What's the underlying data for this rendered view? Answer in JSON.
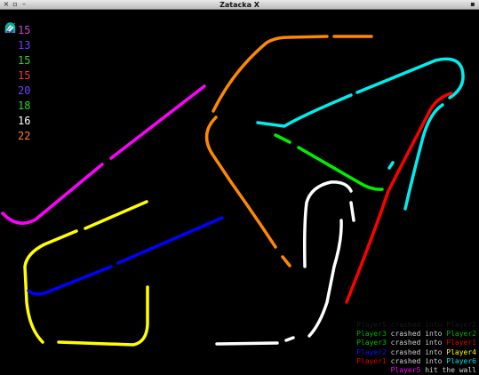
{
  "window": {
    "title": "Zatacka X",
    "buttons": [
      "×",
      "▫",
      "–"
    ]
  },
  "powerups": [
    {
      "icon": "speed-icon",
      "color": "#7f3fbf",
      "count": "15"
    },
    {
      "icon": "warning-icon",
      "color": "#d97c00",
      "count": "13"
    },
    {
      "icon": "lightning-icon",
      "color": "#7fc000",
      "count": "15"
    },
    {
      "icon": "reverse-icon",
      "color": "#d00000",
      "count": "15"
    },
    {
      "icon": "ring-icon",
      "color": "#7f00d0",
      "count": "20"
    },
    {
      "icon": "magnet-icon",
      "color": "#00c0a0",
      "count": "18"
    },
    {
      "icon": "eraser-icon",
      "color": "#ffffff",
      "count": "16"
    },
    {
      "icon": "chaos-icon",
      "color": "#00a0a0",
      "count": "22"
    }
  ],
  "powerup_count_colors": [
    "#d040d0",
    "#7040ff",
    "#30d030",
    "#ff3030",
    "#7040ff",
    "#30d030",
    "#ffffff",
    "#ff8030"
  ],
  "log": [
    {
      "a": "Player5",
      "a_color": "#1a1a1a",
      "verb": "crashed into",
      "b": "Player2",
      "b_color": "#1a1a1a"
    },
    {
      "a": "Player3",
      "a_color": "#00b000",
      "verb": "crashed into",
      "b": "Player2",
      "b_color": "#00b000"
    },
    {
      "a": "Player3",
      "a_color": "#00c000",
      "verb": "crashed into",
      "b": "Player1",
      "b_color": "#e00000"
    },
    {
      "a": "Player2",
      "a_color": "#1010ff",
      "verb": "crashed into",
      "b": "Player4",
      "b_color": "#ffff00"
    },
    {
      "a": "Player1",
      "a_color": "#e00000",
      "verb": "crashed into",
      "b": "Player6",
      "b_color": "#00e0e0"
    },
    {
      "a": "Player5",
      "a_color": "#ff00ff",
      "verb": "hit the wall",
      "b": "",
      "b_color": "#ffffff"
    }
  ],
  "trail_colors": {
    "player1": "#ff0000",
    "player2": "#0000ff",
    "player3": "#00ee00",
    "player4": "#ffff00",
    "player5": "#ff00ff",
    "player6": "#00eeee",
    "player7": "#ff8800",
    "player8": "#ffffff"
  }
}
